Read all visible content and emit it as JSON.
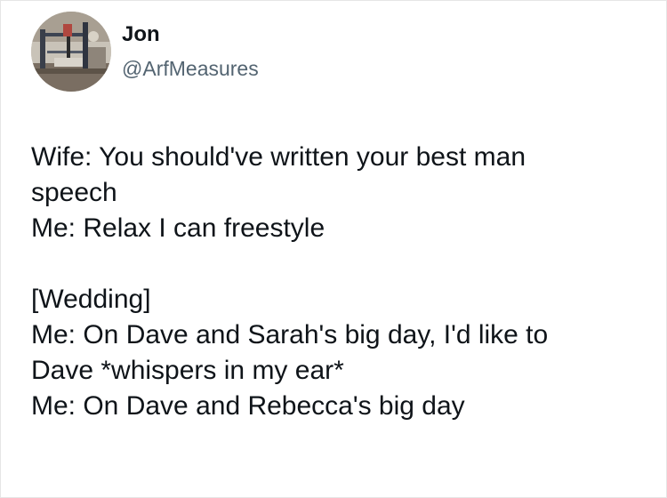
{
  "author": {
    "display_name": "Jon",
    "handle": "@ArfMeasures",
    "avatar_icon": "profile-photo"
  },
  "tweet": {
    "lines": [
      "Wife: You should've written your best man",
      "speech",
      "Me: Relax I can freestyle",
      "",
      "[Wedding]",
      "Me: On Dave and Sarah's big day, I'd like to",
      "Dave *whispers in my ear*",
      "Me: On Dave and Rebecca's big day"
    ]
  },
  "colors": {
    "text": "#0f1419",
    "handle": "#536471"
  }
}
